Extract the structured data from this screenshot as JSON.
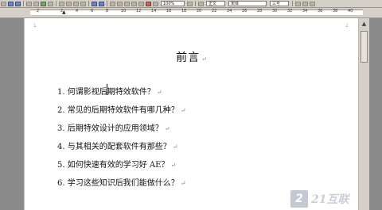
{
  "toolbar": {
    "zoom": "100%",
    "font_name": "宋体",
    "font_size": "三号",
    "style_label": "正文"
  },
  "ruler": {
    "numbers": [
      "2",
      "2",
      "4",
      "6",
      "8",
      "10",
      "12",
      "14",
      "16",
      "18",
      "20",
      "22",
      "24",
      "26",
      "28",
      "30",
      "32",
      "34",
      "36",
      "38",
      "40"
    ]
  },
  "document": {
    "title": "前言",
    "paragraph_mark": "↵",
    "items": [
      "1. 何谓影视后期特效软件？",
      "2. 常见的后期特效软件有哪几种？",
      "3. 后期特效设计的应用领域？",
      "4. 与其相关的配套软件有那些？",
      "5. 如何快速有效的学习好 AE？",
      "6. 学习这些知识后我们能做什么？"
    ]
  },
  "watermark": {
    "logo_char": "2",
    "text": "21互联"
  },
  "icons": {
    "page_corner": "corner-mark",
    "scroll_up": "triangle-up"
  }
}
